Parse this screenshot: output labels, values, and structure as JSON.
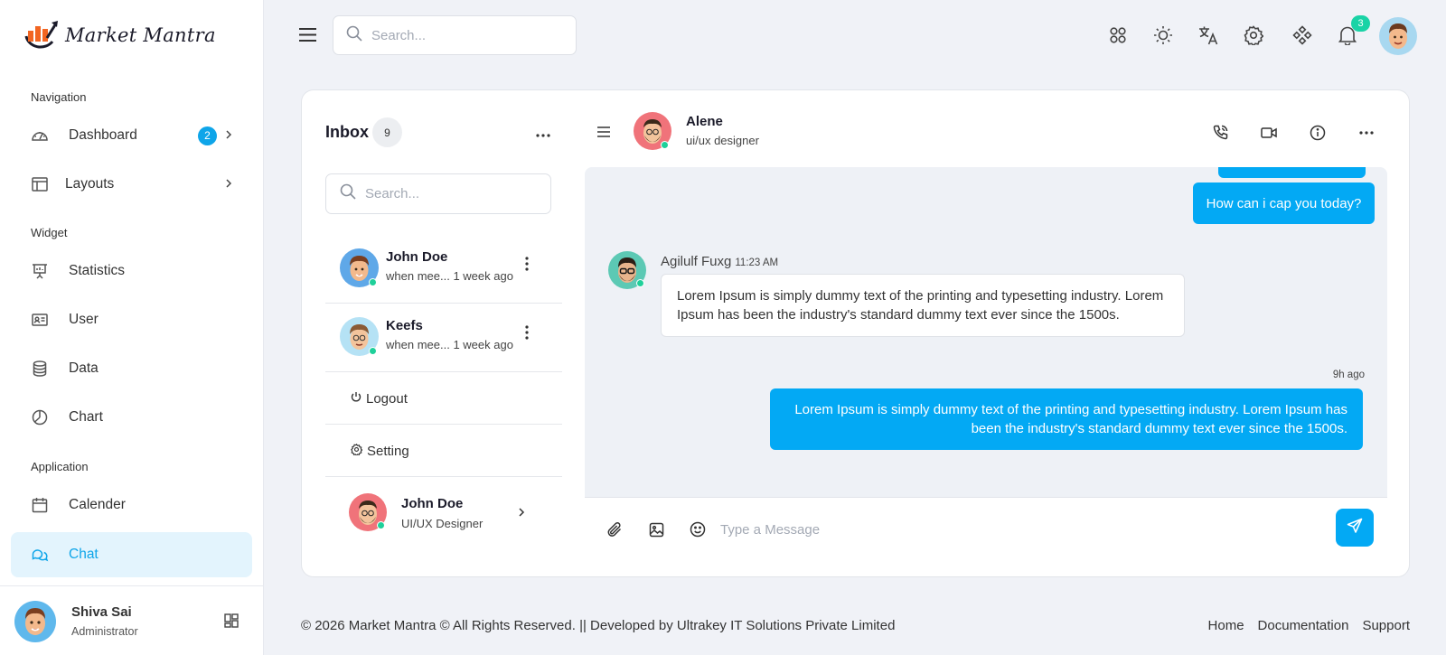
{
  "app": {
    "logo_text": "Market Mantra"
  },
  "sidebar": {
    "sections": {
      "navigation": "Navigation",
      "widget": "Widget",
      "application": "Application"
    },
    "items": {
      "dashboard": {
        "label": "Dashboard",
        "icon": "gauge-icon",
        "badge": "2"
      },
      "layouts": {
        "label": "Layouts",
        "icon": "layout-icon"
      },
      "statistics": {
        "label": "Statistics",
        "icon": "presentation-icon"
      },
      "user": {
        "label": "User",
        "icon": "id-card-icon"
      },
      "data": {
        "label": "Data",
        "icon": "database-icon"
      },
      "chart": {
        "label": "Chart",
        "icon": "pie-chart-icon"
      },
      "calender": {
        "label": "Calender",
        "icon": "calendar-icon"
      },
      "chat": {
        "label": "Chat",
        "icon": "chat-icon",
        "active": true
      }
    },
    "user": {
      "name": "Shiva Sai",
      "role": "Administrator"
    }
  },
  "topbar": {
    "search_placeholder": "Search...",
    "notification_count": "3",
    "icons": [
      "apps-icon",
      "sun-icon",
      "translate-icon",
      "settings-icon",
      "diamond-grid-icon",
      "bell-icon"
    ]
  },
  "inbox": {
    "title": "Inbox",
    "count": "9",
    "search_placeholder": "Search...",
    "conversations": [
      {
        "name": "John Doe",
        "preview": "when mee...",
        "time": "1 week ago"
      },
      {
        "name": "Keefs",
        "preview": "when mee...",
        "time": "1 week ago"
      }
    ],
    "menu": {
      "logout": "Logout",
      "setting": "Setting"
    },
    "profile": {
      "name": "John Doe",
      "role": "UI/UX Designer"
    }
  },
  "chat": {
    "contact_name": "Alene",
    "contact_role": "ui/ux designer",
    "messages": {
      "out_1": "How can i cap you today?",
      "in_sender": "Agilulf Fuxg",
      "in_time": "11:23 AM",
      "in_text": "Lorem Ipsum is simply dummy text of the printing and typesetting industry. Lorem Ipsum has been the industry's standard dummy text ever since the 1500s.",
      "out_2_time": "9h ago",
      "out_2": "Lorem Ipsum is simply dummy text of the printing and typesetting industry. Lorem Ipsum has been the industry's standard dummy text ever since the 1500s."
    },
    "composer_placeholder": "Type a Message"
  },
  "footer": {
    "copyright": "© 2026 Market Mantra © All Rights Reserved. || Developed by Ultrakey IT Solutions Private Limited",
    "links": {
      "home": "Home",
      "documentation": "Documentation",
      "support": "Support"
    }
  },
  "colors": {
    "accent": "#03a9f4",
    "active_bg": "#e3f4fd",
    "online": "#1fd09a"
  }
}
